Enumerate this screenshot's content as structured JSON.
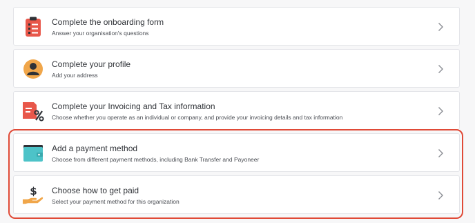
{
  "tasks": [
    {
      "title": "Complete the onboarding form",
      "subtitle": "Answer your organisation's questions",
      "icon": "clipboard-list-icon"
    },
    {
      "title": "Complete your profile",
      "subtitle": "Add your address",
      "icon": "user-avatar-icon"
    },
    {
      "title": "Complete your Invoicing and Tax information",
      "subtitle": "Choose whether you operate as an individual or company, and provide your invoicing details and tax information",
      "icon": "invoice-percent-icon"
    },
    {
      "title": "Add a payment method",
      "subtitle": "Choose from different payment methods, including Bank Transfer and Payoneer",
      "icon": "wallet-icon"
    },
    {
      "title": "Choose how to get paid",
      "subtitle": "Select your payment method for this organization",
      "icon": "hand-dollar-icon"
    }
  ],
  "colors": {
    "accent_red": "#e8574a",
    "accent_orange": "#f0a64a",
    "accent_teal": "#4dc3c8",
    "highlight_border": "#e04a37"
  }
}
